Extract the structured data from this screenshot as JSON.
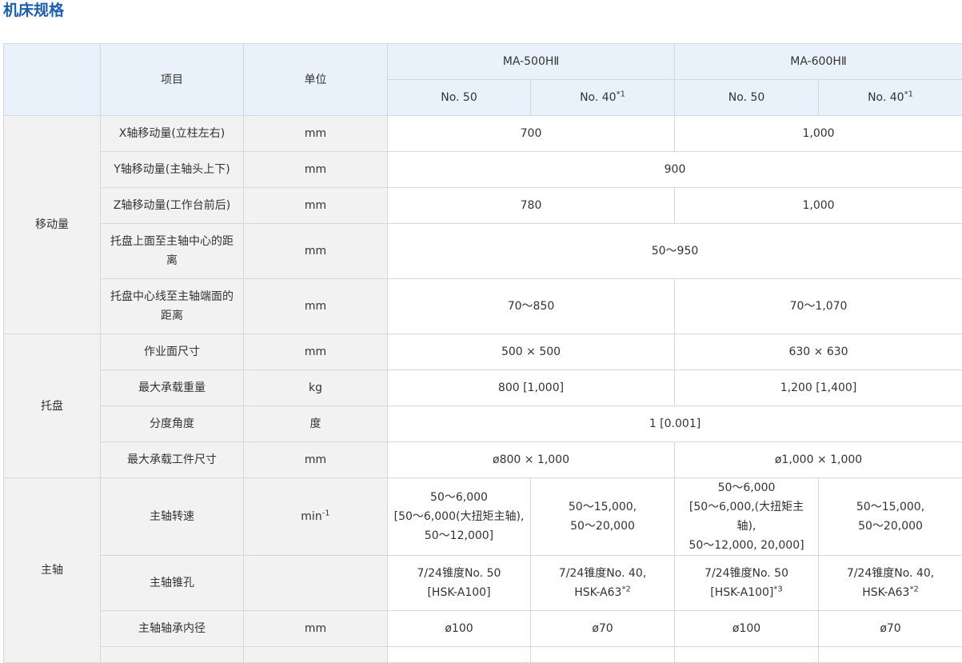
{
  "page_title": "机床规格",
  "header": {
    "item": "项目",
    "unit": "单位",
    "models": [
      "MA-500HⅡ",
      "MA-600HⅡ"
    ],
    "spindles": [
      {
        "label": "No. 50",
        "sup": ""
      },
      {
        "label": "No. 40",
        "sup": "*1"
      },
      {
        "label": "No. 50",
        "sup": ""
      },
      {
        "label": "No. 40",
        "sup": "*1"
      }
    ]
  },
  "groups": {
    "travel": "移动量",
    "pallet": "托盘",
    "spindle": "主轴"
  },
  "rows": {
    "x": {
      "item": "X轴移动量(立柱左右)",
      "unit": "mm",
      "v1": "700",
      "v2": "1,000"
    },
    "y": {
      "item": "Y轴移动量(主轴头上下)",
      "unit": "mm",
      "v": "900"
    },
    "z": {
      "item": "Z轴移动量(工作台前后)",
      "unit": "mm",
      "v1": "780",
      "v2": "1,000"
    },
    "pallet_top": {
      "item_l1": "托盘上面至主轴中心的距",
      "item_l2": "离",
      "unit": "mm",
      "v": "50～950"
    },
    "pallet_center": {
      "item_l1": "托盘中心线至主轴端面的",
      "item_l2": "距离",
      "unit": "mm",
      "v1": "70～850",
      "v2": "70～1,070"
    },
    "work_size": {
      "item": "作业面尺寸",
      "unit": "mm",
      "v1": "500 × 500",
      "v2": "630 × 630"
    },
    "max_load": {
      "item": "最大承载重量",
      "unit": "kg",
      "v1": "800 [1,000]",
      "v2": "1,200 [1,400]"
    },
    "index": {
      "item": "分度角度",
      "unit": "度",
      "v": "1 [0.001]"
    },
    "max_work": {
      "item": "最大承载工件尺寸",
      "unit": "mm",
      "v1": "ø800 × 1,000",
      "v2": "ø1,000 × 1,000"
    },
    "speed": {
      "item": "主轴转速",
      "unit_base": "min",
      "unit_sup": "-1",
      "c1": [
        "50～6,000",
        "[50～6,000(大扭矩主轴),",
        "50～12,000]"
      ],
      "c2": [
        "50～15,000,",
        "50～20,000"
      ],
      "c3": [
        "50～6,000",
        "[50～6,000,(大扭矩主轴),",
        "50～12,000, 20,000]"
      ],
      "c4": [
        "50～15,000,",
        "50～20,000"
      ]
    },
    "taper": {
      "item": "主轴锥孔",
      "unit": "",
      "c1": {
        "l1": "7/24锥度No. 50",
        "l2": "[HSK-A100]",
        "sup": ""
      },
      "c2": {
        "l1": "7/24锥度No. 40,",
        "l2": "HSK-A63",
        "sup": "*2"
      },
      "c3": {
        "l1": "7/24锥度No. 50",
        "l2": "[HSK-A100]",
        "sup": "*3"
      },
      "c4": {
        "l1": "7/24锥度No. 40,",
        "l2": "HSK-A63",
        "sup": "*2"
      }
    },
    "bearing": {
      "item": "主轴轴承内径",
      "unit": "mm",
      "c1": "ø100",
      "c2": "ø70",
      "c3": "ø100",
      "c4": "ø70"
    }
  }
}
